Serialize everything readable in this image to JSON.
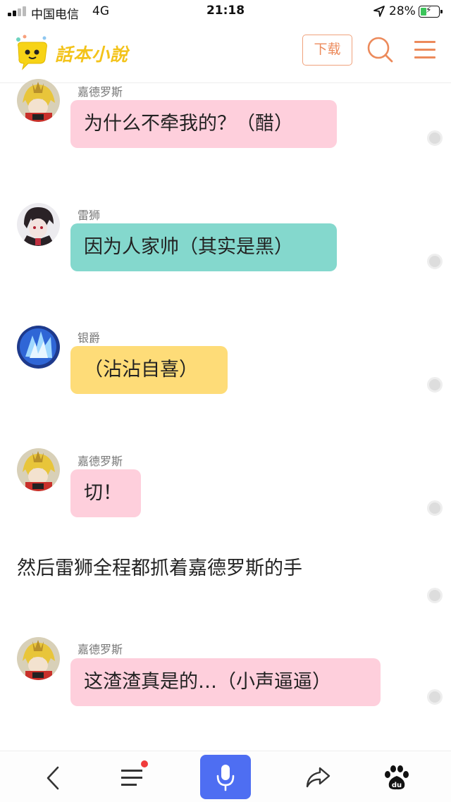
{
  "status_bar": {
    "carrier": "中国电信",
    "network": "4G",
    "time": "21:18",
    "battery": "28%",
    "icons": [
      "signal-icon",
      "location-arrow-icon",
      "battery-charging-icon"
    ]
  },
  "header": {
    "logo_text": "話本小說",
    "download_label": "下载",
    "icons": [
      "logo-icon",
      "search-icon",
      "menu-icon"
    ],
    "accent_color": "#ec8a5b",
    "logo_color": "#f3c31a"
  },
  "messages": [
    {
      "speaker": "嘉德罗斯",
      "text": "为什么不牵我的？（醋）",
      "bubble_color": "#fecfdc",
      "avatar": "avatar-gaderous"
    },
    {
      "speaker": "雷狮",
      "text": "因为人家帅（其实是黑）",
      "bubble_color": "#84d8cd",
      "avatar": "avatar-leishi"
    },
    {
      "speaker": "银爵",
      "text": "（沾沾自喜）",
      "bubble_color": "#fedc78",
      "avatar": "avatar-yinjue"
    },
    {
      "speaker": "嘉德罗斯",
      "text": "切！",
      "bubble_color": "#fecfdc",
      "avatar": "avatar-gaderous"
    }
  ],
  "narration": "然后雷狮全程都抓着嘉德罗斯的手",
  "last_message": {
    "speaker": "嘉德罗斯",
    "text": "这渣渣真是的…（小声逼逼）",
    "bubble_color": "#fecfdc",
    "avatar": "avatar-gaderous"
  },
  "bottom_bar": {
    "icons": [
      "back-icon",
      "chapter-list-icon",
      "microphone-icon",
      "share-icon",
      "baidu-paw-icon"
    ],
    "mic_color": "#4e6ef2",
    "badge_color": "#f03c3c"
  }
}
